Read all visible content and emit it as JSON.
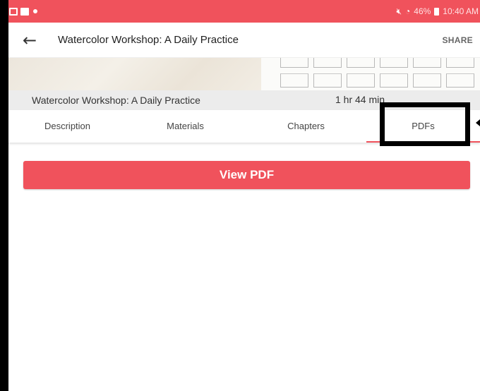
{
  "status_bar": {
    "battery": "46%",
    "time": "10:40 AM",
    "background_color": "#f0525c"
  },
  "app_bar": {
    "title": "Watercolor Workshop: A Daily Practice",
    "share_label": "SHARE",
    "back_icon": "arrow-left-icon"
  },
  "course_info": {
    "name": "Watercolor Workshop: A Daily Practice",
    "duration": "1 hr 44 min"
  },
  "tabs": [
    {
      "label": "Description",
      "selected": false
    },
    {
      "label": "Materials",
      "selected": false
    },
    {
      "label": "Chapters",
      "selected": false
    },
    {
      "label": "PDFs",
      "selected": true
    }
  ],
  "main": {
    "view_pdf_label": "View PDF"
  },
  "colors": {
    "accent": "#f0525c",
    "highlight_annotation": "#000000"
  }
}
